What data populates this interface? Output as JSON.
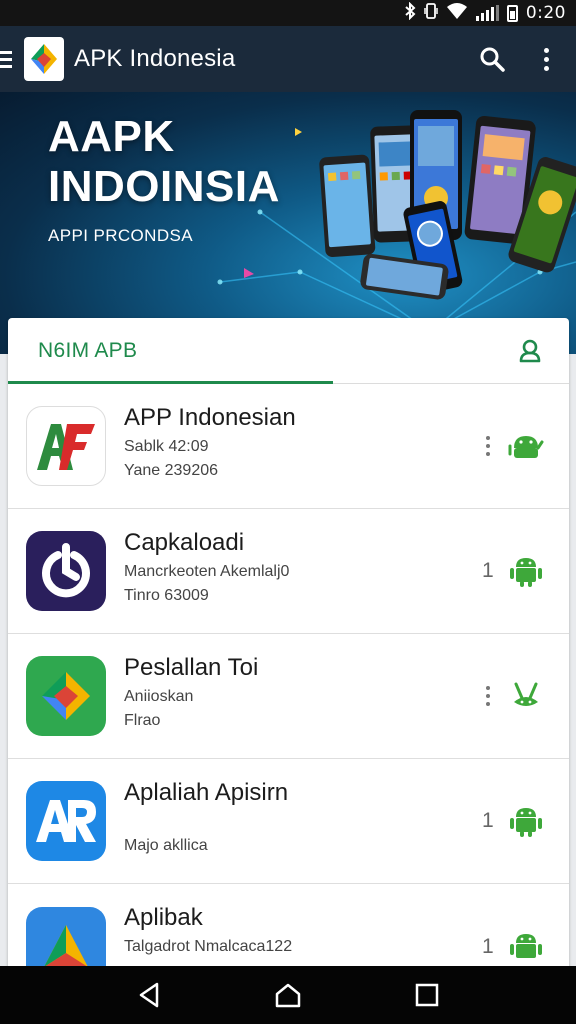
{
  "status_bar": {
    "time": "0:20",
    "icons": [
      "bluetooth-icon",
      "vibrate-icon",
      "wifi-icon",
      "signal-icon",
      "battery-icon"
    ]
  },
  "app_bar": {
    "title": "APK Indonesia",
    "icons": [
      "menu-icon",
      "app-logo",
      "search-icon",
      "more-vert-icon"
    ]
  },
  "banner": {
    "title_line1": "AAPK",
    "title_line2": "INDOINSIA",
    "subtitle": "APPI PRCONDSA"
  },
  "tabs": {
    "active_label": "N6IM APB",
    "action_icon": "person-icon"
  },
  "apps": [
    {
      "name": "APP Indonesian",
      "line1": "Sablk 42:09",
      "line2": "Yane 239206",
      "trailing": "dots",
      "count": "",
      "icon": "af-logo-icon"
    },
    {
      "name": "Capkaloadi",
      "line1": "Mancrkeoten Akemlalj0",
      "line2": "Tinro 63009",
      "trailing": "count",
      "count": "1",
      "icon": "power-circle-icon"
    },
    {
      "name": "Peslallan Toi",
      "line1": "Aniioskan",
      "line2": "Flrao",
      "trailing": "dots",
      "count": "",
      "icon": "colorful-diamond-icon"
    },
    {
      "name": "Aplaliah Apisirn",
      "line1": "",
      "line2": "Majo akllica",
      "trailing": "count",
      "count": "1",
      "icon": "ar-logo-icon"
    },
    {
      "name": "Aplibak",
      "line1": "Talgadrot Nmalcaca122",
      "line2": "",
      "trailing": "count",
      "count": "1",
      "icon": "triangle-logo-icon"
    }
  ],
  "colors": {
    "app_bar": "#1b2a3b",
    "accent_green": "#1f8a4c",
    "android_green": "#3ea83a",
    "status_bar": "#141414",
    "nav_bar": "#050505"
  },
  "nav_bar": {
    "icons": [
      "back-icon",
      "home-icon",
      "recents-icon"
    ]
  }
}
